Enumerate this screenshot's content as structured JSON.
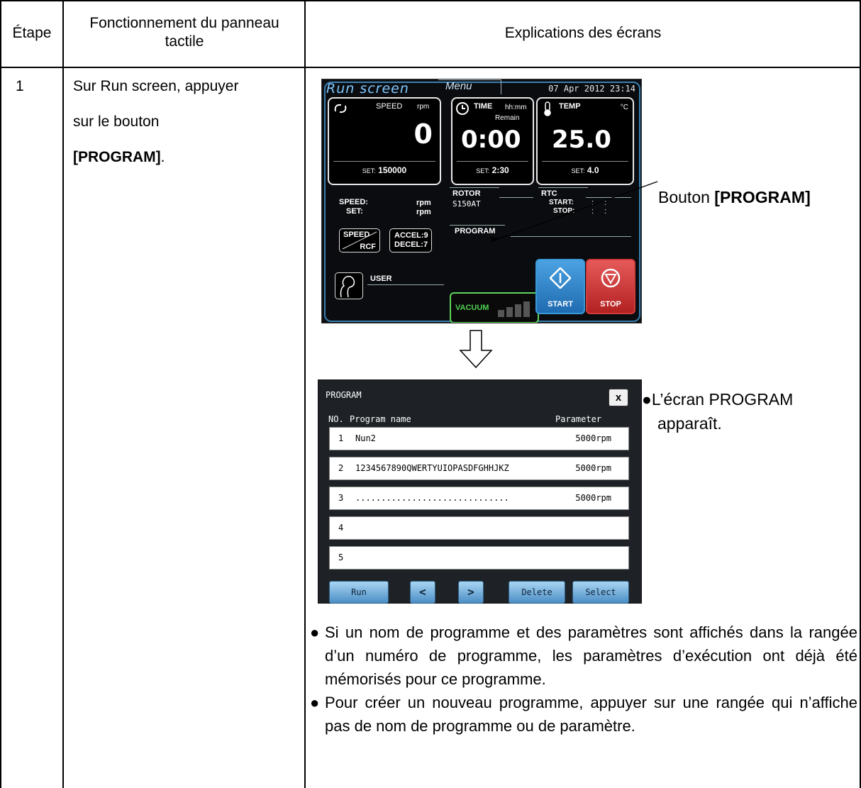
{
  "table": {
    "headers": {
      "step": "Étape",
      "operation": "Fonctionnement du panneau tactile",
      "screens": "Explications des écrans"
    },
    "step_number": "1",
    "operation_text": {
      "line1": "Sur Run screen, appuyer",
      "line2": "sur le bouton",
      "button": "[PROGRAM]",
      "period": "."
    }
  },
  "run_screen": {
    "title": "Run screen",
    "menu_tab": "Menu",
    "date": "07 Apr 2012 23:14",
    "speed": {
      "label": "SPEED",
      "unit": "rpm",
      "value": "0",
      "set_label": "SET:",
      "set_value": "150000"
    },
    "time": {
      "label": "TIME",
      "unit": "hh:mm",
      "sub": "Remain",
      "value": "0:00",
      "set_label": "SET:",
      "set_value": "2:30"
    },
    "temp": {
      "label": "TEMP",
      "unit": "°C",
      "value": "25.0",
      "set_label": "SET:",
      "set_value": "4.0"
    },
    "speed_info": {
      "speed_label": "SPEED:",
      "set_label": "SET:",
      "unit1": "rpm",
      "unit2": "rpm"
    },
    "rotor": {
      "label": "ROTOR",
      "value": "S150AT"
    },
    "rtc": {
      "label": "RTC",
      "start": "START:",
      "stop": "STOP:",
      "start_val": ": :",
      "stop_val": ": :"
    },
    "program_label": "PROGRAM",
    "speed_rcf": {
      "top": "SPEED",
      "bottom": "RCF"
    },
    "accel": "ACCEL:9",
    "decel": "DECEL:7",
    "user": "USER",
    "vacuum": "VACUUM",
    "vacuum_level": 0.5,
    "start": "START",
    "stop": "STOP"
  },
  "callout": {
    "prefix": "Bouton ",
    "button": "[PROGRAM]"
  },
  "program_screen": {
    "title": "PROGRAM",
    "close": "x",
    "col_no": "NO.",
    "col_name": "Program name",
    "col_param": "Parameter",
    "rows": [
      {
        "no": "1",
        "name": "Nun2",
        "param": "5000rpm"
      },
      {
        "no": "2",
        "name": "1234567890QWERTYUIOPASDFGHHJKZ",
        "param": "5000rpm"
      },
      {
        "no": "3",
        "name": "..............................",
        "param": "5000rpm"
      },
      {
        "no": "4",
        "name": "",
        "param": ""
      },
      {
        "no": "5",
        "name": "",
        "param": ""
      }
    ],
    "buttons": {
      "run": "Run",
      "prev": "<",
      "next": ">",
      "delete": "Delete",
      "select": "Select"
    }
  },
  "notes": {
    "appears_line1": "L’écran PROGRAM",
    "appears_line2": "apparaît.",
    "bullet1": "Si un nom de programme et des paramètres sont affichés dans la rangée d’un numéro de programme, les paramètres d’exécution ont déjà été mémorisés pour ce programme.",
    "bullet2": "Pour créer un nouveau programme, appuyer sur une rangée qui n’affiche pas de nom de programme ou de paramètre."
  }
}
